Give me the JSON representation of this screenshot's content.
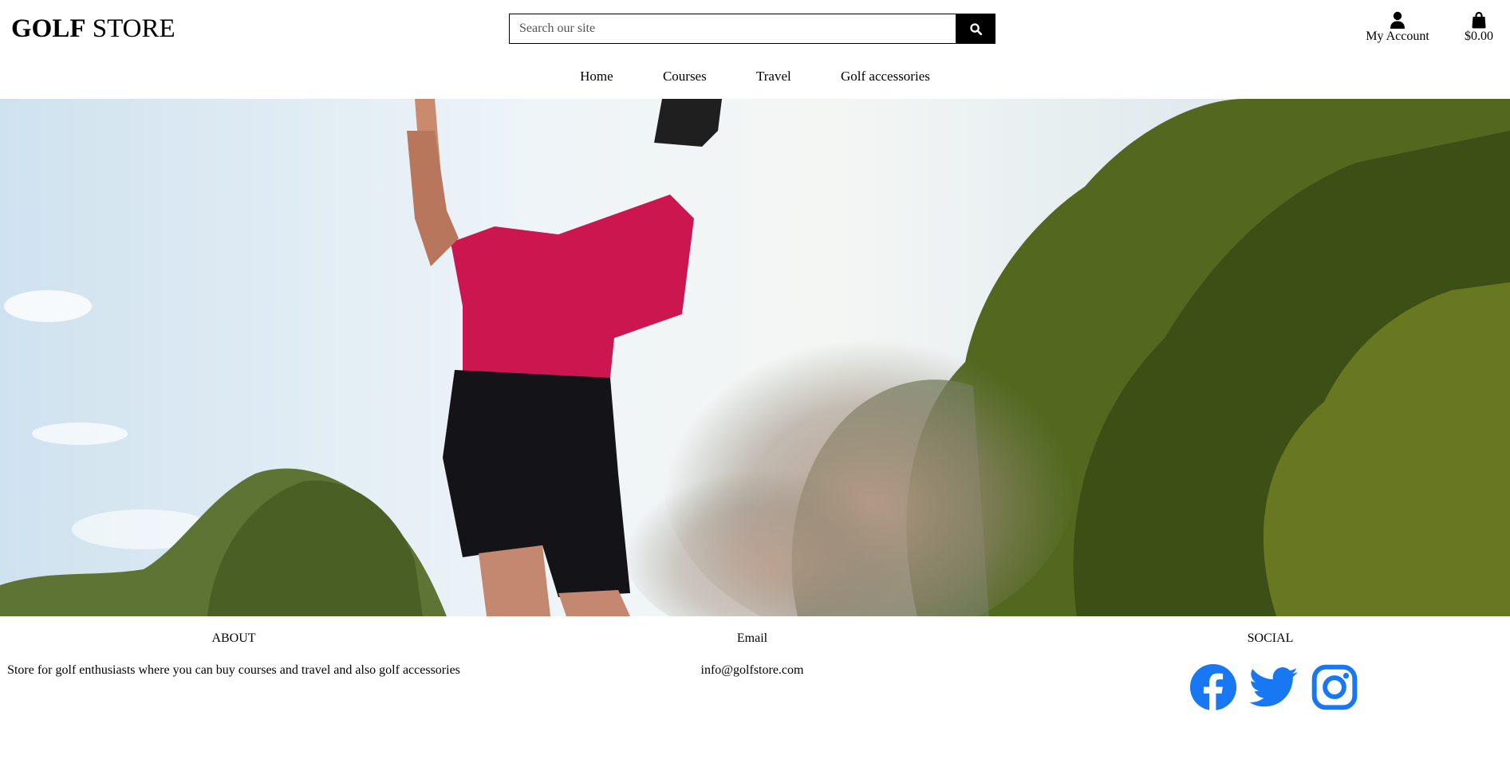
{
  "header": {
    "logo_bold": "GOLF",
    "logo_rest": "STORE",
    "search": {
      "placeholder": "Search our site",
      "button_icon": "search-icon"
    },
    "account": {
      "icon": "user-icon",
      "label": "My Account"
    },
    "cart": {
      "icon": "shopping-bag-icon",
      "total": "$0.00"
    }
  },
  "nav": {
    "items": [
      {
        "label": "Home"
      },
      {
        "label": "Courses"
      },
      {
        "label": "Travel"
      },
      {
        "label": "Golf accessories"
      }
    ]
  },
  "hero": {
    "image": "golfer-swinging-photo"
  },
  "footer": {
    "about": {
      "heading": "ABOUT",
      "text": "Store for golf enthusiasts where you can buy courses and travel and also golf accessories"
    },
    "email": {
      "heading": "Email",
      "address": "info@golfstore.com"
    },
    "social": {
      "heading": "SOCIAL",
      "icons": [
        "facebook-icon",
        "twitter-icon",
        "instagram-icon"
      ],
      "icon_color": "#1877f2"
    }
  }
}
